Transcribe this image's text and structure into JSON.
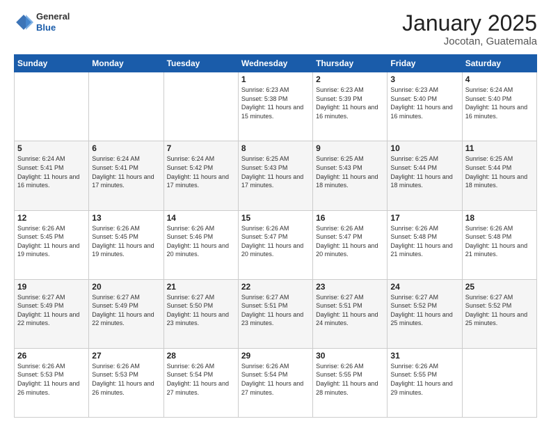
{
  "header": {
    "logo": {
      "general": "General",
      "blue": "Blue"
    },
    "title": "January 2025",
    "subtitle": "Jocotan, Guatemala"
  },
  "calendar": {
    "days_of_week": [
      "Sunday",
      "Monday",
      "Tuesday",
      "Wednesday",
      "Thursday",
      "Friday",
      "Saturday"
    ],
    "weeks": [
      [
        {
          "day": null
        },
        {
          "day": null
        },
        {
          "day": null
        },
        {
          "day": "1",
          "sunrise": "6:23 AM",
          "sunset": "5:38 PM",
          "daylight": "11 hours and 15 minutes."
        },
        {
          "day": "2",
          "sunrise": "6:23 AM",
          "sunset": "5:39 PM",
          "daylight": "11 hours and 16 minutes."
        },
        {
          "day": "3",
          "sunrise": "6:23 AM",
          "sunset": "5:40 PM",
          "daylight": "11 hours and 16 minutes."
        },
        {
          "day": "4",
          "sunrise": "6:24 AM",
          "sunset": "5:40 PM",
          "daylight": "11 hours and 16 minutes."
        }
      ],
      [
        {
          "day": "5",
          "sunrise": "6:24 AM",
          "sunset": "5:41 PM",
          "daylight": "11 hours and 16 minutes."
        },
        {
          "day": "6",
          "sunrise": "6:24 AM",
          "sunset": "5:41 PM",
          "daylight": "11 hours and 17 minutes."
        },
        {
          "day": "7",
          "sunrise": "6:24 AM",
          "sunset": "5:42 PM",
          "daylight": "11 hours and 17 minutes."
        },
        {
          "day": "8",
          "sunrise": "6:25 AM",
          "sunset": "5:43 PM",
          "daylight": "11 hours and 17 minutes."
        },
        {
          "day": "9",
          "sunrise": "6:25 AM",
          "sunset": "5:43 PM",
          "daylight": "11 hours and 18 minutes."
        },
        {
          "day": "10",
          "sunrise": "6:25 AM",
          "sunset": "5:44 PM",
          "daylight": "11 hours and 18 minutes."
        },
        {
          "day": "11",
          "sunrise": "6:25 AM",
          "sunset": "5:44 PM",
          "daylight": "11 hours and 18 minutes."
        }
      ],
      [
        {
          "day": "12",
          "sunrise": "6:26 AM",
          "sunset": "5:45 PM",
          "daylight": "11 hours and 19 minutes."
        },
        {
          "day": "13",
          "sunrise": "6:26 AM",
          "sunset": "5:45 PM",
          "daylight": "11 hours and 19 minutes."
        },
        {
          "day": "14",
          "sunrise": "6:26 AM",
          "sunset": "5:46 PM",
          "daylight": "11 hours and 20 minutes."
        },
        {
          "day": "15",
          "sunrise": "6:26 AM",
          "sunset": "5:47 PM",
          "daylight": "11 hours and 20 minutes."
        },
        {
          "day": "16",
          "sunrise": "6:26 AM",
          "sunset": "5:47 PM",
          "daylight": "11 hours and 20 minutes."
        },
        {
          "day": "17",
          "sunrise": "6:26 AM",
          "sunset": "5:48 PM",
          "daylight": "11 hours and 21 minutes."
        },
        {
          "day": "18",
          "sunrise": "6:26 AM",
          "sunset": "5:48 PM",
          "daylight": "11 hours and 21 minutes."
        }
      ],
      [
        {
          "day": "19",
          "sunrise": "6:27 AM",
          "sunset": "5:49 PM",
          "daylight": "11 hours and 22 minutes."
        },
        {
          "day": "20",
          "sunrise": "6:27 AM",
          "sunset": "5:49 PM",
          "daylight": "11 hours and 22 minutes."
        },
        {
          "day": "21",
          "sunrise": "6:27 AM",
          "sunset": "5:50 PM",
          "daylight": "11 hours and 23 minutes."
        },
        {
          "day": "22",
          "sunrise": "6:27 AM",
          "sunset": "5:51 PM",
          "daylight": "11 hours and 23 minutes."
        },
        {
          "day": "23",
          "sunrise": "6:27 AM",
          "sunset": "5:51 PM",
          "daylight": "11 hours and 24 minutes."
        },
        {
          "day": "24",
          "sunrise": "6:27 AM",
          "sunset": "5:52 PM",
          "daylight": "11 hours and 25 minutes."
        },
        {
          "day": "25",
          "sunrise": "6:27 AM",
          "sunset": "5:52 PM",
          "daylight": "11 hours and 25 minutes."
        }
      ],
      [
        {
          "day": "26",
          "sunrise": "6:26 AM",
          "sunset": "5:53 PM",
          "daylight": "11 hours and 26 minutes."
        },
        {
          "day": "27",
          "sunrise": "6:26 AM",
          "sunset": "5:53 PM",
          "daylight": "11 hours and 26 minutes."
        },
        {
          "day": "28",
          "sunrise": "6:26 AM",
          "sunset": "5:54 PM",
          "daylight": "11 hours and 27 minutes."
        },
        {
          "day": "29",
          "sunrise": "6:26 AM",
          "sunset": "5:54 PM",
          "daylight": "11 hours and 27 minutes."
        },
        {
          "day": "30",
          "sunrise": "6:26 AM",
          "sunset": "5:55 PM",
          "daylight": "11 hours and 28 minutes."
        },
        {
          "day": "31",
          "sunrise": "6:26 AM",
          "sunset": "5:55 PM",
          "daylight": "11 hours and 29 minutes."
        },
        {
          "day": null
        }
      ]
    ],
    "labels": {
      "sunrise": "Sunrise:",
      "sunset": "Sunset:",
      "daylight": "Daylight hours"
    }
  }
}
